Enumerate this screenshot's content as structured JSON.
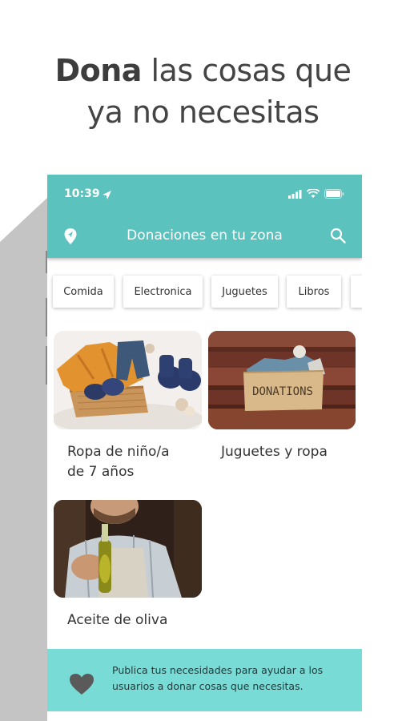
{
  "headline": {
    "bold": "Dona",
    "rest_line1": " las cosas que",
    "line2": "ya no necesitas"
  },
  "status_bar": {
    "time": "10:39"
  },
  "app_bar": {
    "title": "Donaciones en tu zona"
  },
  "categories": [
    "Comida",
    "Electronica",
    "Juguetes",
    "Libros"
  ],
  "items": [
    {
      "title_line1": "Ropa de niño/a",
      "title_line2": "de 7 años"
    },
    {
      "title": "Juguetes y ropa",
      "image_label": "DONATIONS"
    },
    {
      "title": "Aceite de oliva"
    }
  ],
  "banner": {
    "text": "Publica tus necesidades para ayudar a los usuarios a donar cosas que necesitas."
  },
  "colors": {
    "accent": "#5bc2bd",
    "banner": "#79dbd6",
    "shadow": "#c4c4c4"
  }
}
